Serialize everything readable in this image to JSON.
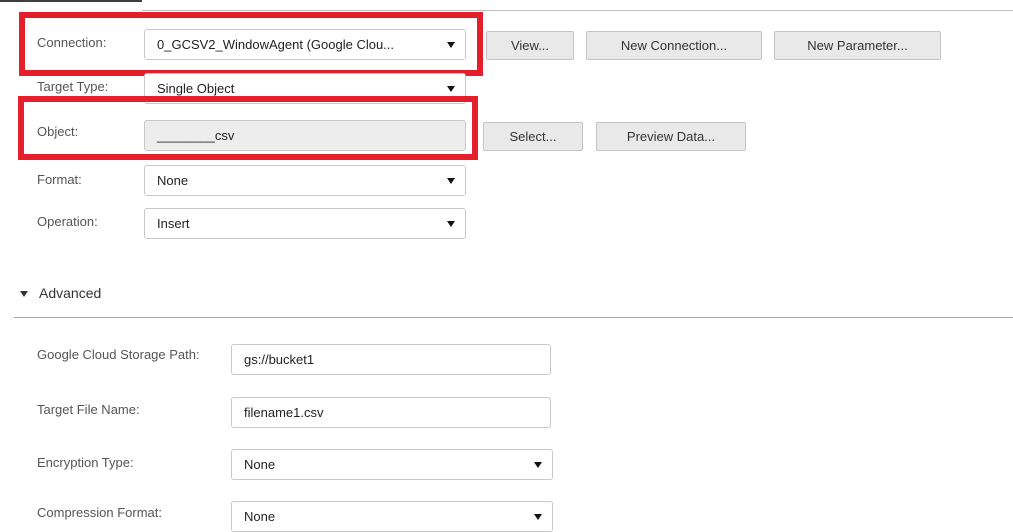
{
  "form": {
    "connection": {
      "label": "Connection:",
      "value": "0_GCSV2_WindowAgent (Google Clou...",
      "buttons": {
        "view": "View...",
        "new_connection": "New Connection...",
        "new_parameter": "New Parameter..."
      }
    },
    "target_type": {
      "label": "Target Type:",
      "value": "Single Object"
    },
    "object": {
      "label": "Object:",
      "value": "________csv",
      "buttons": {
        "select": "Select...",
        "preview": "Preview Data..."
      }
    },
    "format": {
      "label": "Format:",
      "value": "None"
    },
    "operation": {
      "label": "Operation:",
      "value": "Insert"
    }
  },
  "advanced": {
    "title": "Advanced",
    "gcs_path": {
      "label": "Google Cloud Storage Path:",
      "value": "gs://bucket1"
    },
    "target_file_name": {
      "label": "Target File Name:",
      "value": "filename1.csv"
    },
    "encryption_type": {
      "label": "Encryption Type:",
      "value": "None"
    },
    "compression_format": {
      "label": "Compression Format:",
      "value": "None"
    }
  },
  "highlight_color": "#e41e2b"
}
